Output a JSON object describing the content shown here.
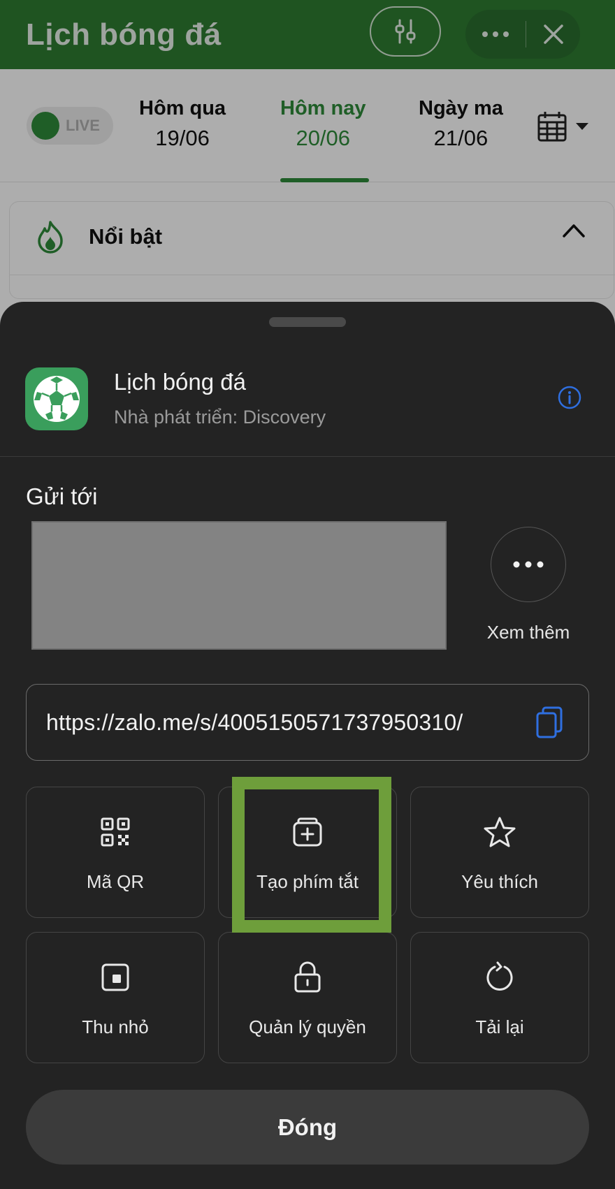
{
  "header": {
    "title": "Lịch bóng đá"
  },
  "date_bar": {
    "live_label": "LIVE",
    "days": [
      {
        "name": "Hôm qua",
        "date": "19/06"
      },
      {
        "name": "Hôm nay",
        "date": "20/06"
      },
      {
        "name": "Ngày ma",
        "date": "21/06"
      }
    ]
  },
  "highlight": {
    "title": "Nổi bật"
  },
  "sheet": {
    "app_name": "Lịch bóng đá",
    "developer": "Nhà phát triển: Discovery",
    "send_to_label": "Gửi tới",
    "see_more_label": "Xem thêm",
    "link_url": "https://zalo.me/s/4005150571737950310/",
    "actions": [
      {
        "label": "Mã QR",
        "icon": "qr-code-icon"
      },
      {
        "label": "Tạo phím tắt",
        "icon": "add-shortcut-icon"
      },
      {
        "label": "Yêu thích",
        "icon": "star-icon"
      },
      {
        "label": "Thu nhỏ",
        "icon": "minimize-icon"
      },
      {
        "label": "Quản lý quyền",
        "icon": "lock-icon"
      },
      {
        "label": "Tải lại",
        "icon": "reload-icon"
      }
    ],
    "close_label": "Đóng"
  },
  "colors": {
    "header_green": "#2f7d32",
    "accent_green": "#2e8b3a",
    "sheet_bg": "#232323",
    "highlight_frame": "#6e9e3b",
    "info_blue": "#2f6fe0"
  }
}
